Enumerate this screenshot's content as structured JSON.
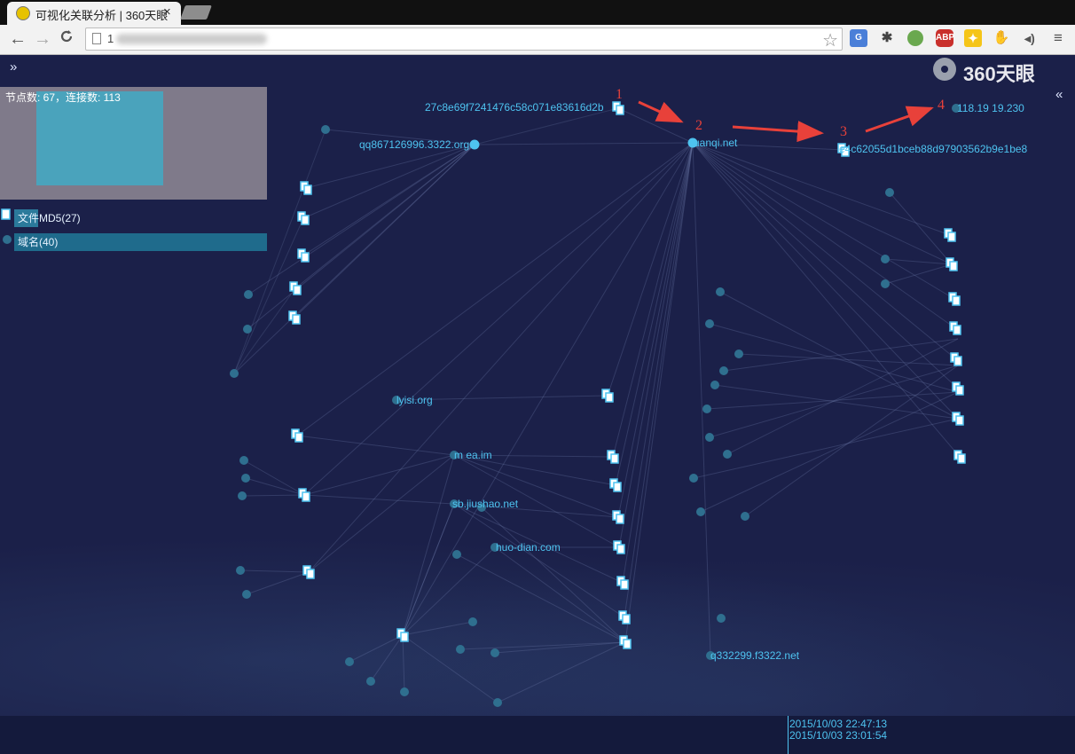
{
  "browser": {
    "tab_title": "可视化关联分析 | 360天眼",
    "tab_close": "×",
    "url": "1",
    "nav": {
      "back": "←",
      "forward": "→",
      "reload": "C"
    },
    "extensions": [
      "translate",
      "bug",
      "circle",
      "ABP",
      "star-burst",
      "glove",
      "speaker",
      "menu"
    ],
    "abp_label": "ABP"
  },
  "app": {
    "expand_icon": "»",
    "collapse_icon": "«",
    "logo_text": "360天眼",
    "stats": "节点数: 67，连接数: 113",
    "legend": [
      {
        "label": "文件MD5(27)"
      },
      {
        "label": "域名(40)"
      }
    ],
    "timeline": {
      "start": "2015/10/03 22:47:13",
      "end": "2015/10/03 23:01:54"
    },
    "annotations": [
      "1",
      "2",
      "3",
      "4"
    ]
  },
  "graph": {
    "labels": [
      {
        "id": "md5a",
        "text": "27c8e69f7241476c58c071e83616d2b"
      },
      {
        "id": "qq",
        "text": "qq867126996.3322.org"
      },
      {
        "id": "hub",
        "text": "uanqi.net"
      },
      {
        "id": "md5b",
        "text": "e4c62055d1bceb88d97903562b9e1be8"
      },
      {
        "id": "ip",
        "text": "118.19    19.230"
      },
      {
        "id": "lyisi",
        "text": "lyisi.org"
      },
      {
        "id": "ea",
        "text": "m    ea.im"
      },
      {
        "id": "sb",
        "text": "sb.jiushao.net"
      },
      {
        "id": "huo",
        "text": "huo-dian.com"
      },
      {
        "id": "q332",
        "text": "q332299.f3322.net"
      }
    ]
  },
  "colors": {
    "background": "#1b2049",
    "node": "#2f6f8f",
    "file_node": "#4ec3f0",
    "label": "#4ec3f0",
    "arrow": "#e8413a"
  }
}
